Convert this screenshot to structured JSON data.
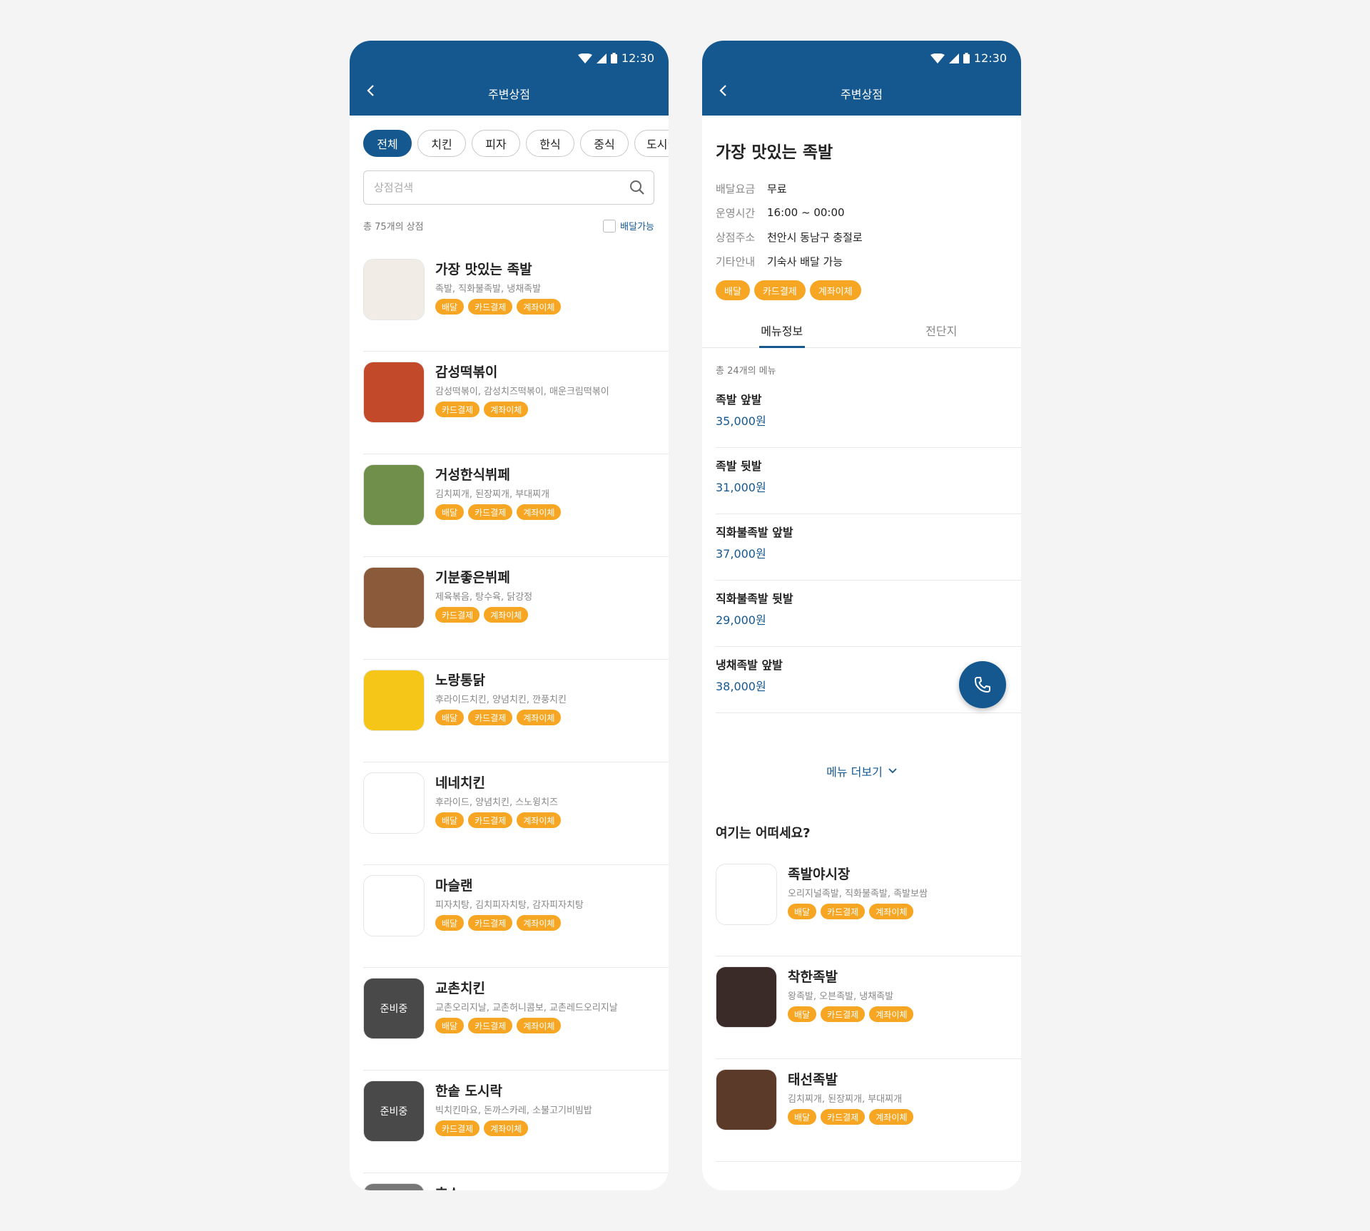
{
  "status": {
    "time": "12:30"
  },
  "left": {
    "title": "주변상점",
    "chips": [
      "전체",
      "치킨",
      "피자",
      "한식",
      "중식",
      "도시락"
    ],
    "search_placeholder": "상점검색",
    "count_text": "총 75개의 상점",
    "delivery_filter": "배달가능",
    "stores": [
      {
        "name": "가장 맛있는 족발",
        "desc": "족발, 직화불족발, 냉채족발",
        "tags": [
          "배달",
          "카드결제",
          "계좌이체"
        ],
        "thumb_color": "#f1ede6",
        "preparing": false
      },
      {
        "name": "감성떡볶이",
        "desc": "감성떡볶이, 감성치즈떡볶이, 매운크림떡볶이",
        "tags": [
          "카드결제",
          "계좌이체"
        ],
        "thumb_color": "#c24a2a",
        "preparing": false
      },
      {
        "name": "거성한식뷔페",
        "desc": "김치찌개, 된장찌개, 부대찌개",
        "tags": [
          "배달",
          "카드결제",
          "계좌이체"
        ],
        "thumb_color": "#6f8f4a",
        "preparing": false
      },
      {
        "name": "기분좋은뷔페",
        "desc": "제육볶음, 탕수육, 닭강정",
        "tags": [
          "카드결제",
          "계좌이체"
        ],
        "thumb_color": "#8a5a3a",
        "preparing": false
      },
      {
        "name": "노랑통닭",
        "desc": "후라이드치킨, 양념치킨, 깐풍치킨",
        "tags": [
          "배달",
          "카드결제",
          "계좌이체"
        ],
        "thumb_color": "#f5c518",
        "preparing": false
      },
      {
        "name": "네네치킨",
        "desc": "후라이드, 양념치킨, 스노윙치즈",
        "tags": [
          "배달",
          "카드결제",
          "계좌이체"
        ],
        "thumb_color": "#ffffff",
        "preparing": false
      },
      {
        "name": "마슬랜",
        "desc": "피자치탕, 김치피자치탕, 감자피자치탕",
        "tags": [
          "배달",
          "카드결제",
          "계좌이체"
        ],
        "thumb_color": "#ffffff",
        "preparing": false
      },
      {
        "name": "교촌치킨",
        "desc": "교촌오리지날, 교촌허니콤보, 교촌레드오리지날",
        "tags": [
          "배달",
          "카드결제",
          "계좌이체"
        ],
        "thumb_color": "#777777",
        "preparing": true,
        "prep_label": "준비중"
      },
      {
        "name": "한솥 도시락",
        "desc": "빅치킨마요, 돈까스카레, 소불고기비빔밥",
        "tags": [
          "카드결제",
          "계좌이체"
        ],
        "thumb_color": "#777777",
        "preparing": true,
        "prep_label": "준비중"
      },
      {
        "name": "호스",
        "desc": "",
        "tags": [],
        "thumb_color": "#777777",
        "preparing": false
      }
    ]
  },
  "right": {
    "title": "주변상점",
    "store_name": "가장 맛있는 족발",
    "info": [
      {
        "k": "배달요금",
        "v": "무료"
      },
      {
        "k": "운영시간",
        "v": "16:00 ~ 00:00"
      },
      {
        "k": "상점주소",
        "v": "천안시 동남구 충절로"
      },
      {
        "k": "기타안내",
        "v": "기숙사 배달 가능"
      }
    ],
    "tags": [
      "배달",
      "카드결제",
      "계좌이체"
    ],
    "tabs": [
      "메뉴정보",
      "전단지"
    ],
    "menu_count": "총 24개의 메뉴",
    "menus": [
      {
        "name": "족발 앞발",
        "price": "35,000원"
      },
      {
        "name": "족발 뒷발",
        "price": "31,000원"
      },
      {
        "name": "직화불족발 앞발",
        "price": "37,000원"
      },
      {
        "name": "직화불족발 뒷발",
        "price": "29,000원"
      },
      {
        "name": "냉채족발 앞발",
        "price": "38,000원"
      }
    ],
    "more_label": "메뉴 더보기",
    "reco_title": "여기는 어떠세요?",
    "reco": [
      {
        "name": "족발야시장",
        "desc": "오리지널족발, 직화불족발, 족발보쌈",
        "tags": [
          "배달",
          "카드결제",
          "계좌이체"
        ],
        "thumb_color": "#ffffff"
      },
      {
        "name": "착한족발",
        "desc": "왕족발, 오븐족발, 냉채족발",
        "tags": [
          "배달",
          "카드결제",
          "계좌이체"
        ],
        "thumb_color": "#3a2b28"
      },
      {
        "name": "태선족발",
        "desc": "김치찌개, 된장찌개, 부대찌개",
        "tags": [
          "배달",
          "카드결제",
          "계좌이체"
        ],
        "thumb_color": "#5b3a2a"
      }
    ]
  },
  "colors": {
    "primary": "#155890",
    "tag": "#f6a623"
  }
}
